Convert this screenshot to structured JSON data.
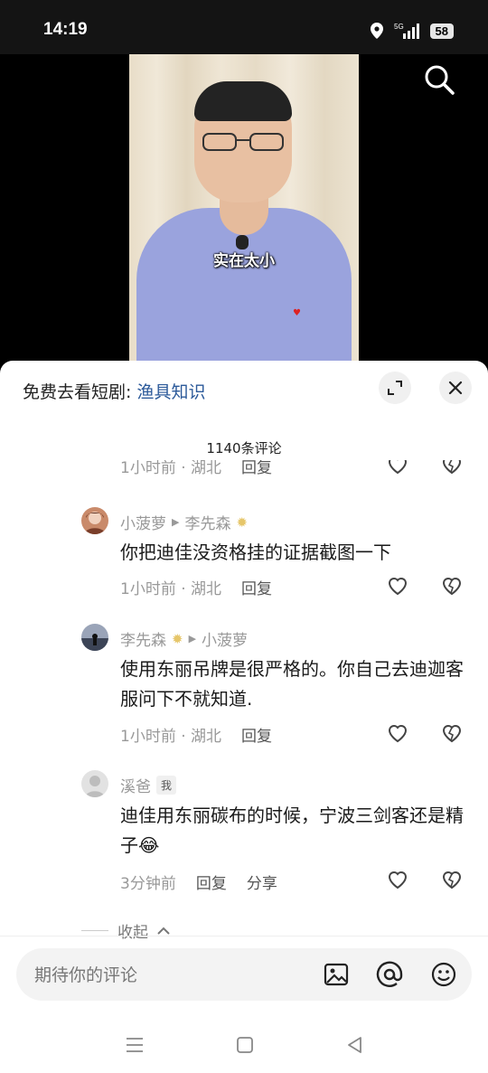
{
  "status_bar": {
    "time": "14:19",
    "network": "5G",
    "battery": "58"
  },
  "video": {
    "subtitle": "实在太小"
  },
  "sheet": {
    "header_prefix": "免费去看短剧: ",
    "header_link": "渔具知识",
    "comment_count": "1140条评论"
  },
  "partial_meta": {
    "time": "1小时前 · 湖北",
    "reply": "回复"
  },
  "comments": [
    {
      "user": "小菠萝",
      "reply_to": "李先森",
      "text": "你把迪佳没资格挂的证据截图一下",
      "time": "1小时前 · 湖北",
      "reply": "回复"
    },
    {
      "user": "李先森",
      "reply_to": "小菠萝",
      "text": "使用东丽吊牌是很严格的。你自己去迪迦客服问下不就知道.",
      "time": "1小时前 · 湖北",
      "reply": "回复"
    },
    {
      "user": "溪爸",
      "tag": "我",
      "text": "迪佳用东丽碳布的时候，宁波三剑客还是精子😂",
      "time": "3分钟前",
      "reply": "回复",
      "share": "分享"
    }
  ],
  "collapse_label": "收起",
  "input": {
    "placeholder": "期待你的评论"
  },
  "colors": {
    "link": "#2c5a9a",
    "muted": "#999999",
    "sheet_bg": "#ffffff"
  }
}
